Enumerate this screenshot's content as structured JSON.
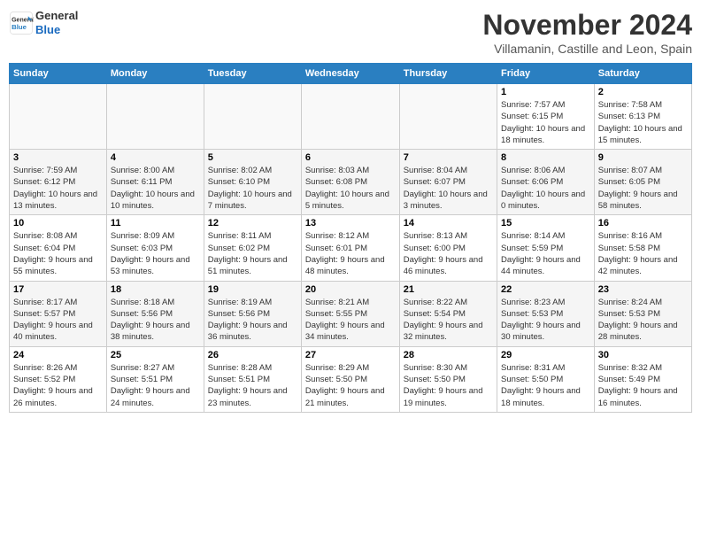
{
  "header": {
    "logo_line1": "General",
    "logo_line2": "Blue",
    "month": "November 2024",
    "location": "Villamanin, Castille and Leon, Spain"
  },
  "days_of_week": [
    "Sunday",
    "Monday",
    "Tuesday",
    "Wednesday",
    "Thursday",
    "Friday",
    "Saturday"
  ],
  "weeks": [
    [
      {
        "day": "",
        "info": ""
      },
      {
        "day": "",
        "info": ""
      },
      {
        "day": "",
        "info": ""
      },
      {
        "day": "",
        "info": ""
      },
      {
        "day": "",
        "info": ""
      },
      {
        "day": "1",
        "info": "Sunrise: 7:57 AM\nSunset: 6:15 PM\nDaylight: 10 hours and 18 minutes."
      },
      {
        "day": "2",
        "info": "Sunrise: 7:58 AM\nSunset: 6:13 PM\nDaylight: 10 hours and 15 minutes."
      }
    ],
    [
      {
        "day": "3",
        "info": "Sunrise: 7:59 AM\nSunset: 6:12 PM\nDaylight: 10 hours and 13 minutes."
      },
      {
        "day": "4",
        "info": "Sunrise: 8:00 AM\nSunset: 6:11 PM\nDaylight: 10 hours and 10 minutes."
      },
      {
        "day": "5",
        "info": "Sunrise: 8:02 AM\nSunset: 6:10 PM\nDaylight: 10 hours and 7 minutes."
      },
      {
        "day": "6",
        "info": "Sunrise: 8:03 AM\nSunset: 6:08 PM\nDaylight: 10 hours and 5 minutes."
      },
      {
        "day": "7",
        "info": "Sunrise: 8:04 AM\nSunset: 6:07 PM\nDaylight: 10 hours and 3 minutes."
      },
      {
        "day": "8",
        "info": "Sunrise: 8:06 AM\nSunset: 6:06 PM\nDaylight: 10 hours and 0 minutes."
      },
      {
        "day": "9",
        "info": "Sunrise: 8:07 AM\nSunset: 6:05 PM\nDaylight: 9 hours and 58 minutes."
      }
    ],
    [
      {
        "day": "10",
        "info": "Sunrise: 8:08 AM\nSunset: 6:04 PM\nDaylight: 9 hours and 55 minutes."
      },
      {
        "day": "11",
        "info": "Sunrise: 8:09 AM\nSunset: 6:03 PM\nDaylight: 9 hours and 53 minutes."
      },
      {
        "day": "12",
        "info": "Sunrise: 8:11 AM\nSunset: 6:02 PM\nDaylight: 9 hours and 51 minutes."
      },
      {
        "day": "13",
        "info": "Sunrise: 8:12 AM\nSunset: 6:01 PM\nDaylight: 9 hours and 48 minutes."
      },
      {
        "day": "14",
        "info": "Sunrise: 8:13 AM\nSunset: 6:00 PM\nDaylight: 9 hours and 46 minutes."
      },
      {
        "day": "15",
        "info": "Sunrise: 8:14 AM\nSunset: 5:59 PM\nDaylight: 9 hours and 44 minutes."
      },
      {
        "day": "16",
        "info": "Sunrise: 8:16 AM\nSunset: 5:58 PM\nDaylight: 9 hours and 42 minutes."
      }
    ],
    [
      {
        "day": "17",
        "info": "Sunrise: 8:17 AM\nSunset: 5:57 PM\nDaylight: 9 hours and 40 minutes."
      },
      {
        "day": "18",
        "info": "Sunrise: 8:18 AM\nSunset: 5:56 PM\nDaylight: 9 hours and 38 minutes."
      },
      {
        "day": "19",
        "info": "Sunrise: 8:19 AM\nSunset: 5:56 PM\nDaylight: 9 hours and 36 minutes."
      },
      {
        "day": "20",
        "info": "Sunrise: 8:21 AM\nSunset: 5:55 PM\nDaylight: 9 hours and 34 minutes."
      },
      {
        "day": "21",
        "info": "Sunrise: 8:22 AM\nSunset: 5:54 PM\nDaylight: 9 hours and 32 minutes."
      },
      {
        "day": "22",
        "info": "Sunrise: 8:23 AM\nSunset: 5:53 PM\nDaylight: 9 hours and 30 minutes."
      },
      {
        "day": "23",
        "info": "Sunrise: 8:24 AM\nSunset: 5:53 PM\nDaylight: 9 hours and 28 minutes."
      }
    ],
    [
      {
        "day": "24",
        "info": "Sunrise: 8:26 AM\nSunset: 5:52 PM\nDaylight: 9 hours and 26 minutes."
      },
      {
        "day": "25",
        "info": "Sunrise: 8:27 AM\nSunset: 5:51 PM\nDaylight: 9 hours and 24 minutes."
      },
      {
        "day": "26",
        "info": "Sunrise: 8:28 AM\nSunset: 5:51 PM\nDaylight: 9 hours and 23 minutes."
      },
      {
        "day": "27",
        "info": "Sunrise: 8:29 AM\nSunset: 5:50 PM\nDaylight: 9 hours and 21 minutes."
      },
      {
        "day": "28",
        "info": "Sunrise: 8:30 AM\nSunset: 5:50 PM\nDaylight: 9 hours and 19 minutes."
      },
      {
        "day": "29",
        "info": "Sunrise: 8:31 AM\nSunset: 5:50 PM\nDaylight: 9 hours and 18 minutes."
      },
      {
        "day": "30",
        "info": "Sunrise: 8:32 AM\nSunset: 5:49 PM\nDaylight: 9 hours and 16 minutes."
      }
    ]
  ]
}
